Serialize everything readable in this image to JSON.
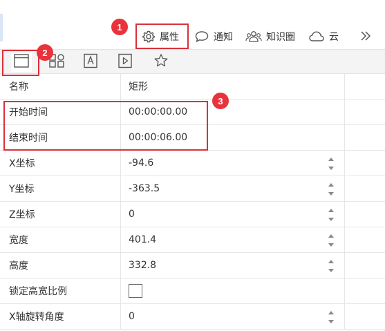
{
  "toolbar": {
    "properties_label": "属性",
    "notify_label": "通知",
    "knowledge_label": "知识圈",
    "cloud_label": "云"
  },
  "tabs": [
    {
      "icon": "window-icon",
      "active": true
    },
    {
      "icon": "grid-icon",
      "active": false
    },
    {
      "icon": "text-box-icon",
      "active": false
    },
    {
      "icon": "play-box-icon",
      "active": false
    },
    {
      "icon": "star-icon",
      "active": false
    }
  ],
  "properties": {
    "name": {
      "label": "名称",
      "value": "矩形"
    },
    "start": {
      "label": "开始时间",
      "value": "00:00:00.00"
    },
    "end": {
      "label": "结束时间",
      "value": "00:00:06.00"
    },
    "x": {
      "label": "X坐标",
      "value": "-94.6"
    },
    "y": {
      "label": "Y坐标",
      "value": "-363.5"
    },
    "z": {
      "label": "Z坐标",
      "value": "0"
    },
    "width": {
      "label": "宽度",
      "value": "401.4"
    },
    "height": {
      "label": "高度",
      "value": "332.8"
    },
    "lock": {
      "label": "锁定高宽比例"
    },
    "xrot": {
      "label": "X轴旋转角度",
      "value": "0"
    }
  },
  "annotations": {
    "badge1": "1",
    "badge2": "2",
    "badge3": "3",
    "color": "#e8333d"
  }
}
